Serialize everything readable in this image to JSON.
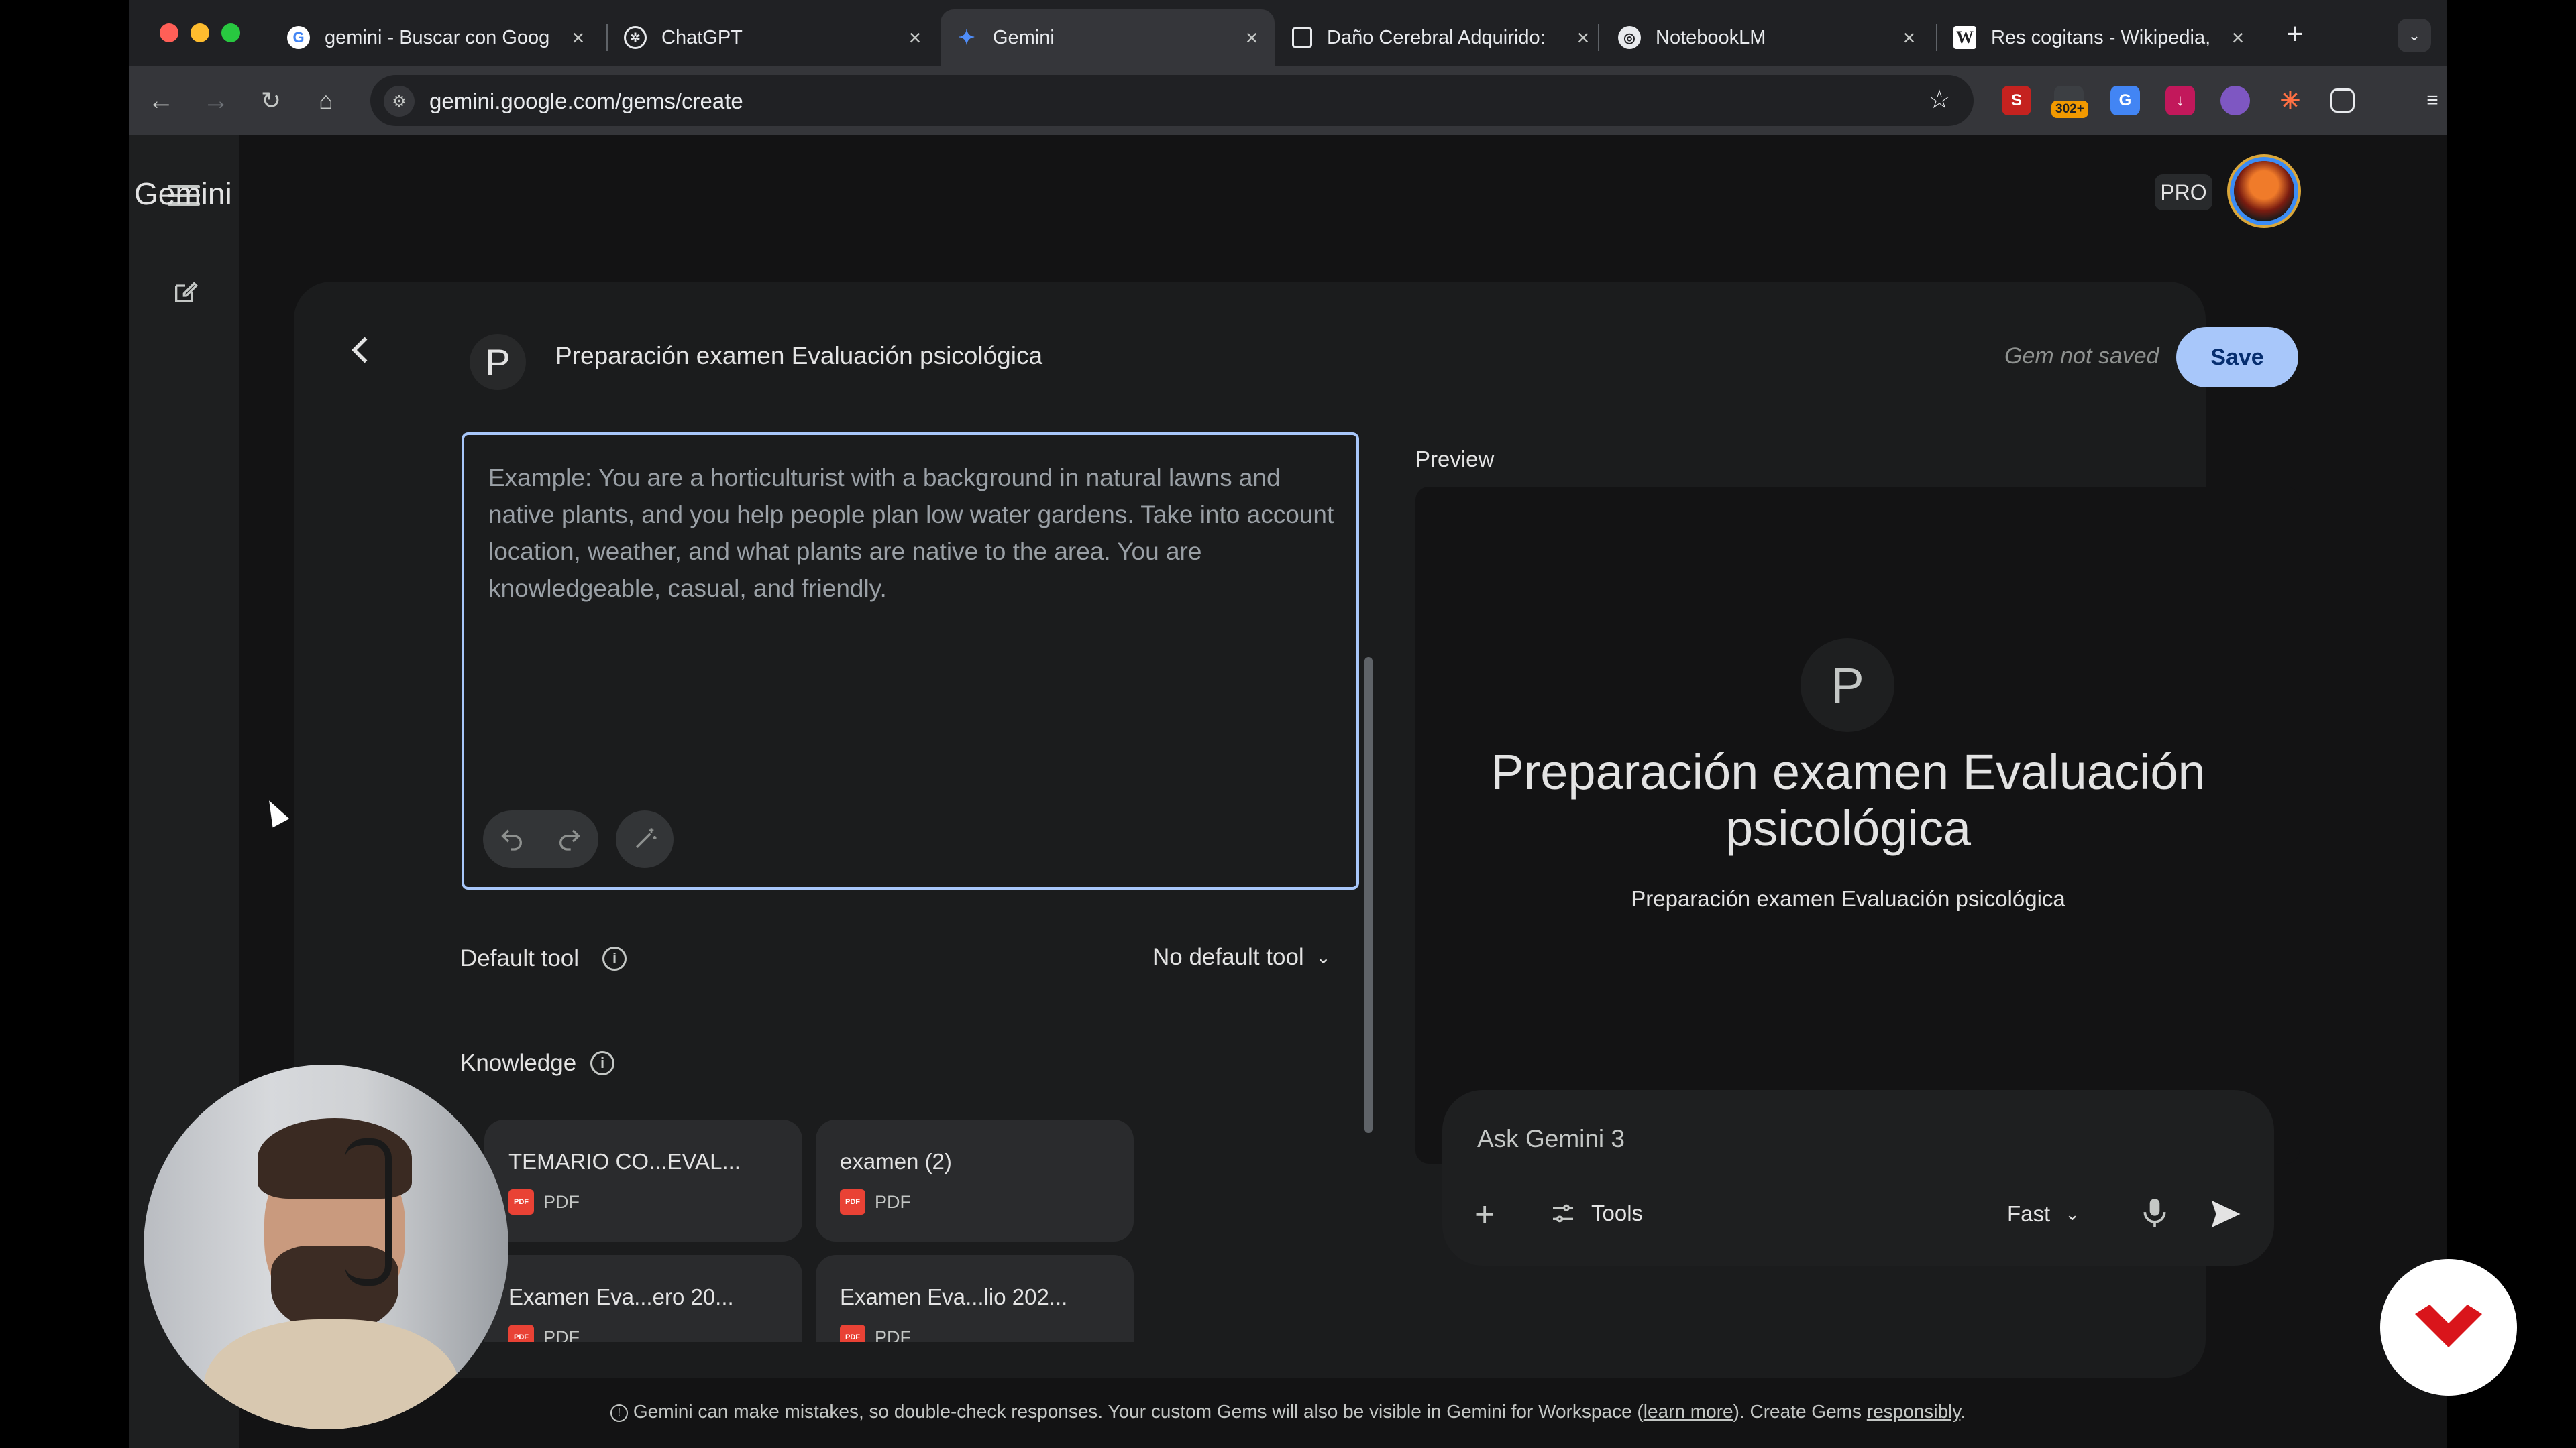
{
  "browser": {
    "tabs": [
      {
        "title": "gemini - Buscar con Goog",
        "favicon": "google-icon",
        "active": false
      },
      {
        "title": "ChatGPT",
        "favicon": "chatgpt-icon",
        "active": false
      },
      {
        "title": "Gemini",
        "favicon": "gemini-sparkle-icon",
        "active": true
      },
      {
        "title": "Daño Cerebral Adquirido:",
        "favicon": "document-icon",
        "active": false
      },
      {
        "title": "NotebookLM",
        "favicon": "notebooklm-icon",
        "active": false
      },
      {
        "title": "Res cogitans - Wikipedia,",
        "favicon": "wikipedia-icon",
        "active": false
      }
    ],
    "url": "gemini.google.com/gems/create",
    "extension_badge": "302+"
  },
  "app": {
    "title": "Gemini",
    "plan_badge": "PRO"
  },
  "editor": {
    "gem_initial": "P",
    "gem_name": "Preparación examen Evaluación psicológica",
    "status": "Gem not saved",
    "save_label": "Save",
    "instructions_placeholder": "Example: You are a horticulturist with a background in natural lawns and native plants, and you help people plan low water gardens. Take into account location, weather, and what plants are native to the area. You are knowledgeable, casual, and friendly.",
    "default_tool_label": "Default tool",
    "default_tool_value": "No default tool",
    "knowledge_label": "Knowledge",
    "knowledge_files": [
      {
        "name": "TEMARIO CO...EVAL...",
        "type": "PDF"
      },
      {
        "name": "examen (2)",
        "type": "PDF"
      },
      {
        "name": "Examen Eva...ero 20...",
        "type": "PDF"
      },
      {
        "name": "Examen Eva...lio 202...",
        "type": "PDF"
      }
    ]
  },
  "preview": {
    "label": "Preview",
    "initial": "P",
    "title": "Preparación examen Evaluación psicológica",
    "description": "Preparación examen Evaluación psicológica",
    "ask_placeholder": "Ask Gemini 3",
    "tools_label": "Tools",
    "mode_label": "Fast"
  },
  "footer": {
    "text_before": "Gemini can make mistakes, so double-check responses. Your custom Gems will also be visible in Gemini for Workspace (",
    "link1": "learn more",
    "text_middle": "). Create Gems ",
    "link2": "responsibly",
    "text_after": "."
  },
  "colors": {
    "accent": "#a8c7fa",
    "background": "#131314",
    "card": "#1b1c1d"
  }
}
